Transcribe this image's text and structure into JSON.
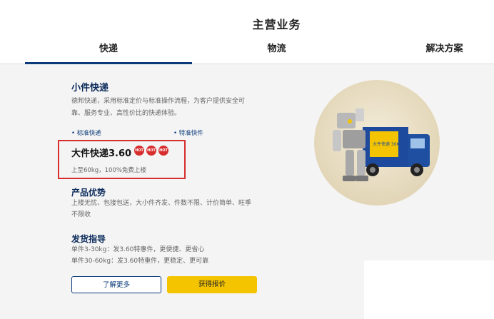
{
  "header": {
    "title": "主营业务"
  },
  "tabs": [
    {
      "label": "快递"
    },
    {
      "label": "物流"
    },
    {
      "label": "解决方案"
    }
  ],
  "small_express": {
    "title": "小件快递",
    "desc_line1": "德邦快递，采用标准定价与标准操作流程，为客户提供安全可",
    "desc_line2": "靠、服务专业、高性价比的快递体验。",
    "bullet1": "标准快递",
    "bullet2": "特准快件"
  },
  "big_express": {
    "title": "大件快递3.60",
    "badges": [
      "HOT",
      "HOT",
      "HOT"
    ],
    "note": "上至60kg，100%免费上楼"
  },
  "advantage": {
    "title": "产品优势",
    "line1": "上楼无忧、包接包送，大小件齐发、件数不限、计价简单、旺季",
    "line2": "不限收"
  },
  "guide": {
    "title": "发货指导",
    "line1": "单件3-30kg：发3.60特惠件，更便捷、更省心",
    "line2": "单件30-60kg：发3.60特重件，更稳定、更可靠"
  },
  "buttons": {
    "learn_more": "了解更多",
    "get_quote": "获得报价"
  },
  "illustration": {
    "truck_text": "大件快递 30KG",
    "icon": "robot-truck-illustration"
  },
  "colors": {
    "accent": "#0a3a7a",
    "highlight": "#d72d2d",
    "quote_button": "#f4c400"
  }
}
